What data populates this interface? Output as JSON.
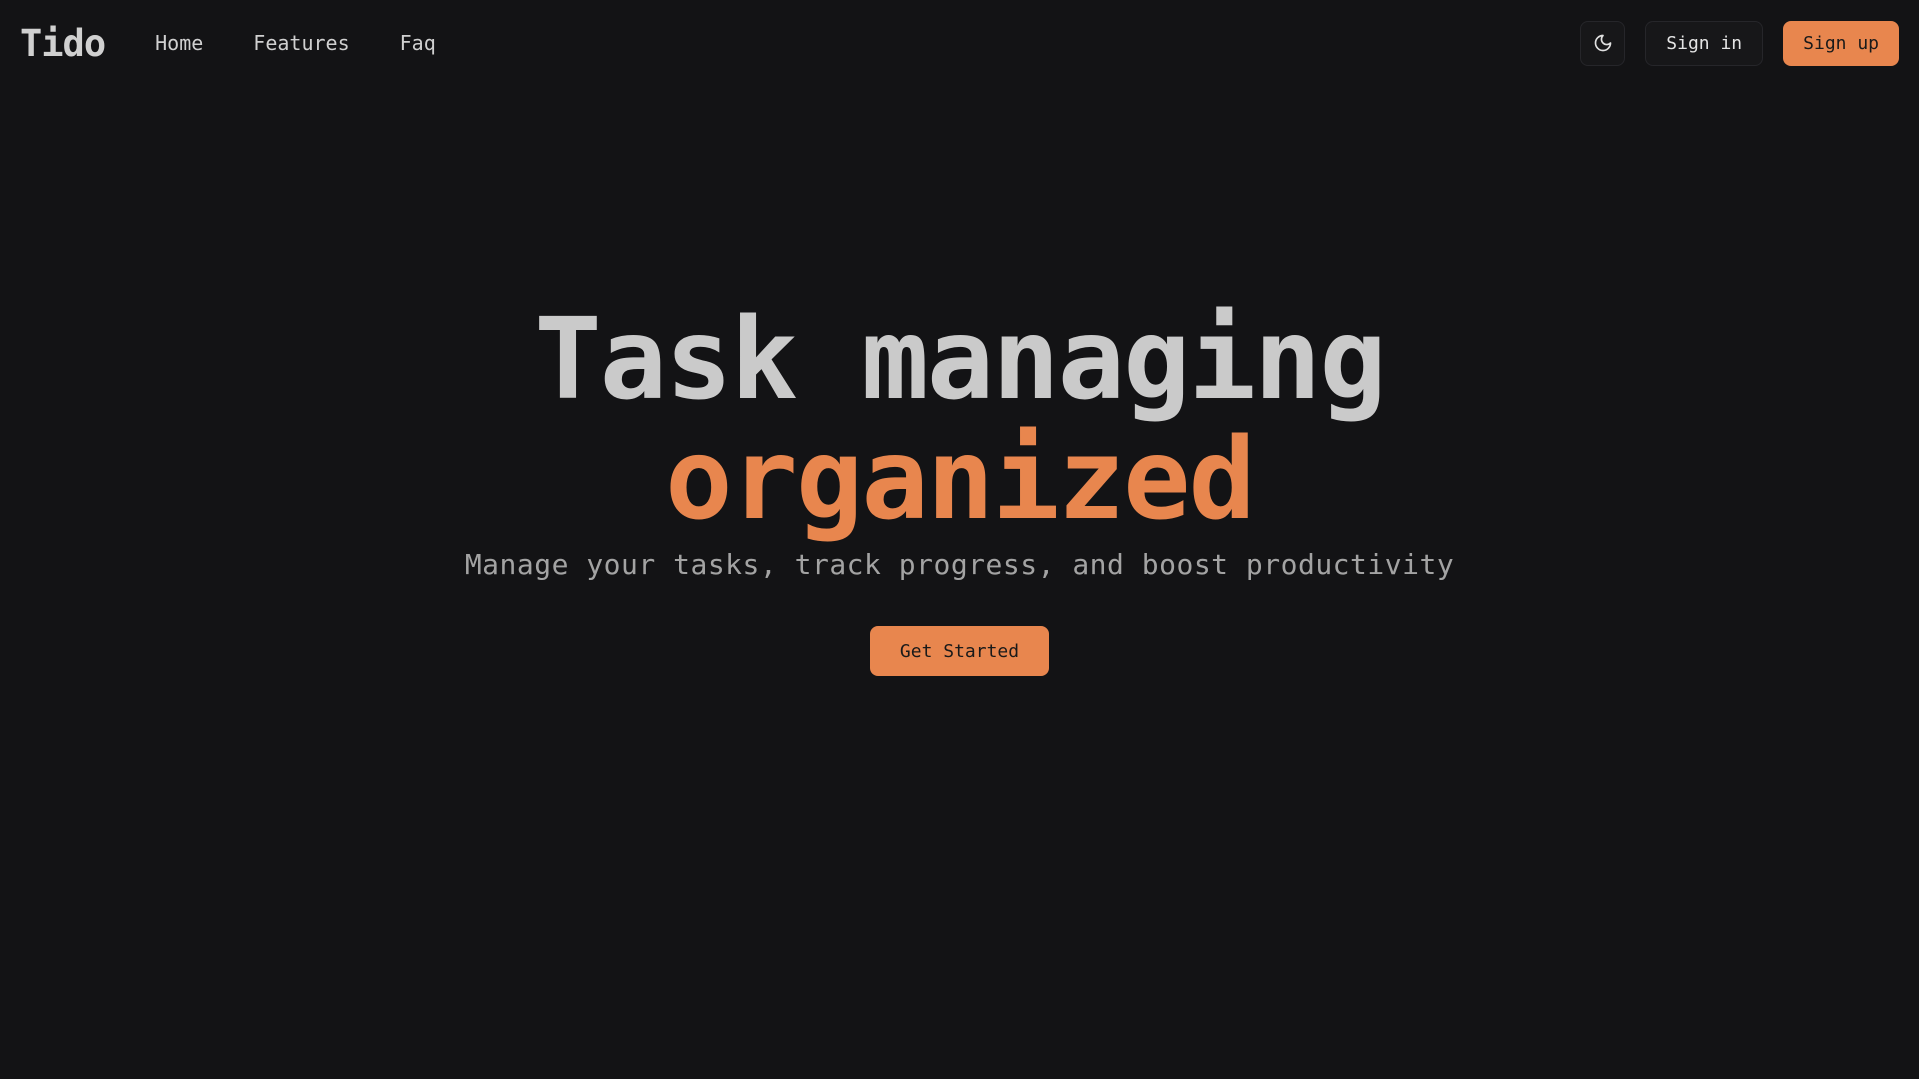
{
  "header": {
    "logo": "Tido",
    "nav": {
      "home": "Home",
      "features": "Features",
      "faq": "Faq"
    },
    "theme_toggle_icon": "moon-icon",
    "signin_label": "Sign in",
    "signup_label": "Sign up"
  },
  "hero": {
    "title_line1": "Task managing",
    "title_line2": "organized",
    "subtitle": "Manage your tasks, track progress, and boost productivity",
    "cta_label": "Get Started"
  },
  "colors": {
    "background": "#131315",
    "accent": "#e8864e",
    "text_primary": "#cacaca",
    "text_muted": "#a3a3a3"
  }
}
